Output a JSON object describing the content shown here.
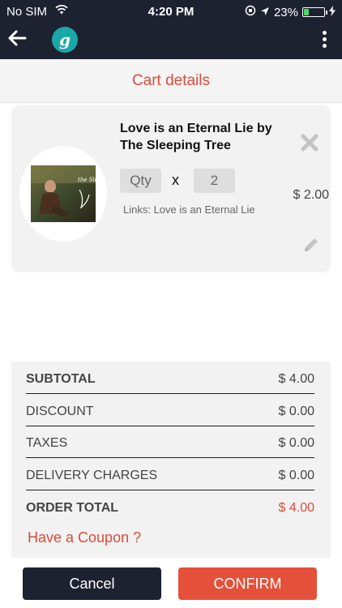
{
  "status_bar": {
    "carrier": "No SIM",
    "time": "4:20 PM",
    "battery": "23%",
    "battery_level": 0.23
  },
  "header": {
    "logo_text": "g",
    "icons": [
      "back-arrow-icon",
      "logo-icon",
      "more-vertical-icon"
    ]
  },
  "page": {
    "title": "Cart details"
  },
  "cart_item": {
    "title": "Love is an Eternal Lie by The Sleeping Tree",
    "qty_label": "Qty",
    "times": "x",
    "quantity": "2",
    "price": "$ 2.00",
    "links": "Links: Love is an Eternal Lie",
    "album_text": "the Sleeping Tree"
  },
  "totals": [
    {
      "label": "SUBTOTAL",
      "value": "$ 4.00"
    },
    {
      "label": "DISCOUNT",
      "value": "$ 0.00"
    },
    {
      "label": "TAXES",
      "value": "$ 0.00"
    },
    {
      "label": "DELIVERY CHARGES",
      "value": "$ 0.00"
    },
    {
      "label": "ORDER TOTAL",
      "value": "$ 4.00"
    }
  ],
  "coupon_link": "Have a Coupon ?",
  "buttons": {
    "cancel": "Cancel",
    "confirm": "CONFIRM"
  },
  "colors": {
    "header_bg": "#1d2231",
    "accent": "#e04a38",
    "logo": "#1aa7a8"
  }
}
